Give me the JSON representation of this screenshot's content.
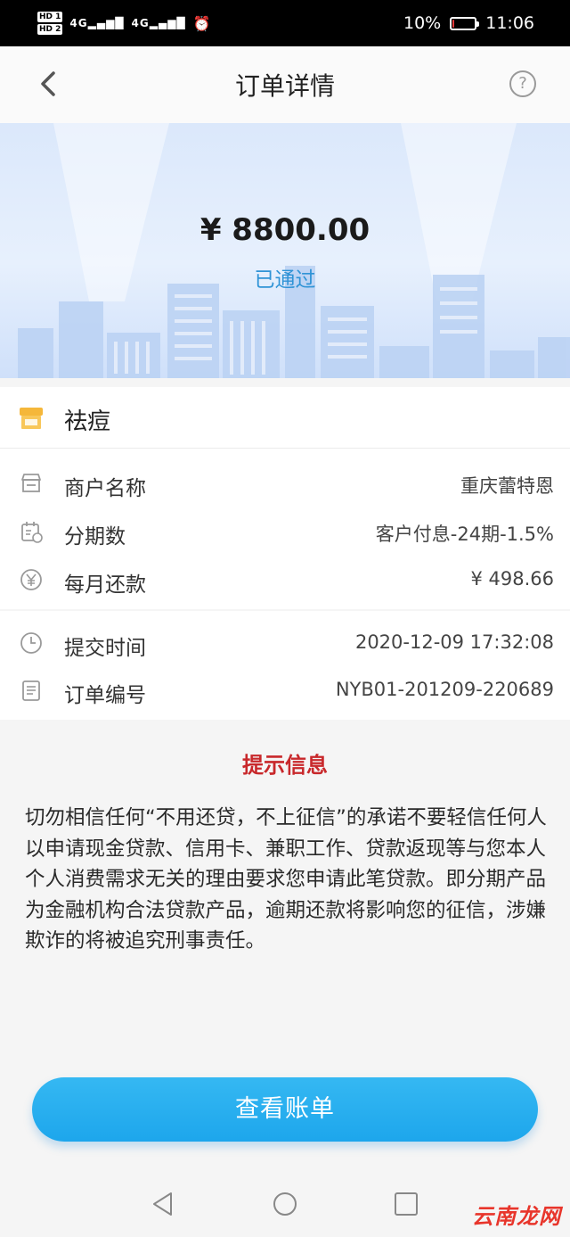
{
  "status_bar": {
    "hd1": "HD 1",
    "hd2": "HD 2",
    "signal1": "4G",
    "signal2": "4G",
    "battery_percent": "10%",
    "battery_level": 0.1,
    "time": "11:06"
  },
  "nav": {
    "title": "订单详情",
    "help_symbol": "?"
  },
  "hero": {
    "amount": "¥ 8800.00",
    "status": "已通过"
  },
  "product": {
    "name": "祛痘"
  },
  "details": [
    {
      "label": "商户名称",
      "value": "重庆蕾特恩",
      "icon": "store-icon"
    },
    {
      "label": "分期数",
      "value": "客户付息-24期-1.5%",
      "icon": "calendar-icon"
    },
    {
      "label": "每月还款",
      "value": "¥ 498.66",
      "icon": "yen-circle-icon"
    }
  ],
  "details2": [
    {
      "label": "提交时间",
      "value": "2020-12-09 17:32:08",
      "icon": "clock-icon"
    },
    {
      "label": "订单编号",
      "value": "NYB01-201209-220689",
      "icon": "document-icon"
    }
  ],
  "notice": {
    "title": "提示信息",
    "text": "切勿相信任何“不用还贷，不上征信”的承诺不要轻信任何人以申请现金贷款、信用卡、兼职工作、贷款返现等与您本人个人消费需求无关的理由要求您申请此笔贷款。即分期产品为金融机构合法贷款产品，逾期还款将影响您的征信，涉嫌欺诈的将被追究刑事责任。"
  },
  "button": {
    "label": "查看账单"
  },
  "watermark": "云南龙网",
  "colors": {
    "accent": "#1da6ec",
    "status": "#2f93d6",
    "notice_title": "#c8282b"
  }
}
